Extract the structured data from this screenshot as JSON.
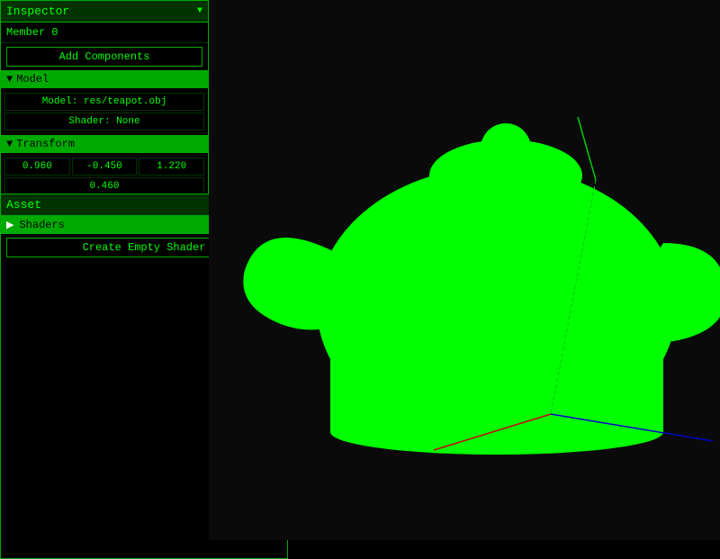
{
  "inspector": {
    "title": "Inspector",
    "arrow": "▼",
    "member": "Member 0",
    "add_components_label": "Add Components",
    "model_section": {
      "label": "Model",
      "model_path": "Model: res/teapot.obj",
      "shader": "Shader: None"
    },
    "transform_section": {
      "label": "Transform",
      "x": "0.960",
      "y": "-0.450",
      "z": "1.220",
      "w": "0.460"
    }
  },
  "asset": {
    "title": "Asset",
    "minimize_label": "▼",
    "close_label": "✕",
    "shaders_label": "Shaders",
    "create_shader_label": "Create Empty Shader"
  },
  "colors": {
    "green_bright": "#00ff00",
    "green_dark": "#003300",
    "green_mid": "#00aa00",
    "black": "#000000"
  }
}
